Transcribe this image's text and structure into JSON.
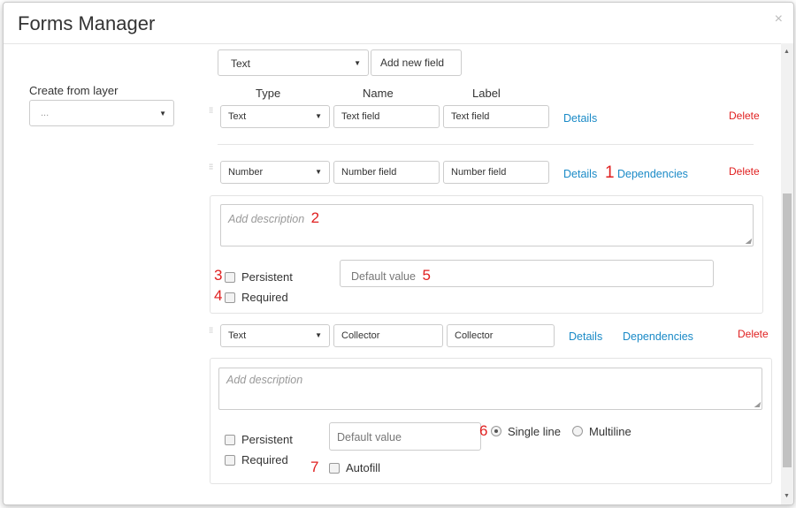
{
  "modal": {
    "title": "Forms Manager",
    "close_glyph": "×"
  },
  "sidebar": {
    "create_label": "Create from layer",
    "create_value": "..."
  },
  "toolbar": {
    "type_value": "Text",
    "add_label": "Add new field"
  },
  "columns": {
    "type": "Type",
    "name": "Name",
    "label": "Label"
  },
  "fields": [
    {
      "type": "Text",
      "name": "Text field",
      "label": "Text field",
      "details": "Details",
      "delete": "Delete"
    },
    {
      "type": "Number",
      "name": "Number field",
      "label": "Number field",
      "details": "Details",
      "dependencies": "Dependencies",
      "delete": "Delete",
      "description_placeholder": "Add description",
      "persistent": "Persistent",
      "required": "Required",
      "default_placeholder": "Default value"
    },
    {
      "type": "Text",
      "name": "Collector",
      "label": "Collector",
      "details": "Details",
      "dependencies": "Dependencies",
      "delete": "Delete",
      "description_placeholder": "Add description",
      "persistent": "Persistent",
      "required": "Required",
      "default_placeholder": "Default value",
      "single_line": "Single line",
      "multiline": "Multiline",
      "autofill": "Autofill",
      "line_mode": "single"
    }
  ],
  "markers": [
    "1",
    "2",
    "3",
    "4",
    "5",
    "6",
    "7"
  ],
  "colors": {
    "link": "#1a8ac7",
    "delete": "#e02020",
    "marker": "#e02020"
  }
}
